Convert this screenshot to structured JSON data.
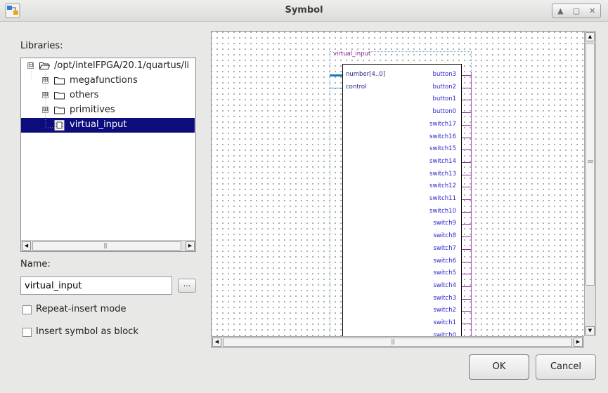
{
  "window": {
    "title": "Symbol"
  },
  "libraries": {
    "label": "Libraries:",
    "tree": [
      {
        "text": "/opt/intelFPGA/20.1/quartus/li",
        "expander": "⊟"
      },
      {
        "text": "megafunctions",
        "expander": "⊞"
      },
      {
        "text": "others",
        "expander": "⊞"
      },
      {
        "text": "primitives",
        "expander": "⊞"
      },
      {
        "text": "virtual_input",
        "selected": true
      }
    ]
  },
  "name": {
    "label": "Name:",
    "value": "virtual_input",
    "browse_label": "..."
  },
  "options": {
    "repeat_insert": {
      "label": "Repeat-insert mode",
      "checked": false
    },
    "insert_as_block": {
      "label": "Insert symbol as block",
      "checked": false
    }
  },
  "symbol": {
    "name": "virtual_input",
    "inputs": [
      "number[4..0]",
      "control"
    ],
    "outputs": [
      "button3",
      "button2",
      "button1",
      "button0",
      "switch17",
      "switch16",
      "switch15",
      "switch14",
      "switch13",
      "switch12",
      "switch11",
      "switch10",
      "switch9",
      "switch8",
      "switch7",
      "switch6",
      "switch5",
      "switch4",
      "switch3",
      "switch2",
      "switch1",
      "switch0"
    ]
  },
  "buttons": {
    "ok": "OK",
    "cancel": "Cancel"
  },
  "colors": {
    "selection": "#0c0c7c",
    "pin_label": "#2b26cc",
    "symbol_name": "#7a1f8c",
    "output_wire": "#8a2e9a",
    "bus_wire": "#1c76c8"
  }
}
